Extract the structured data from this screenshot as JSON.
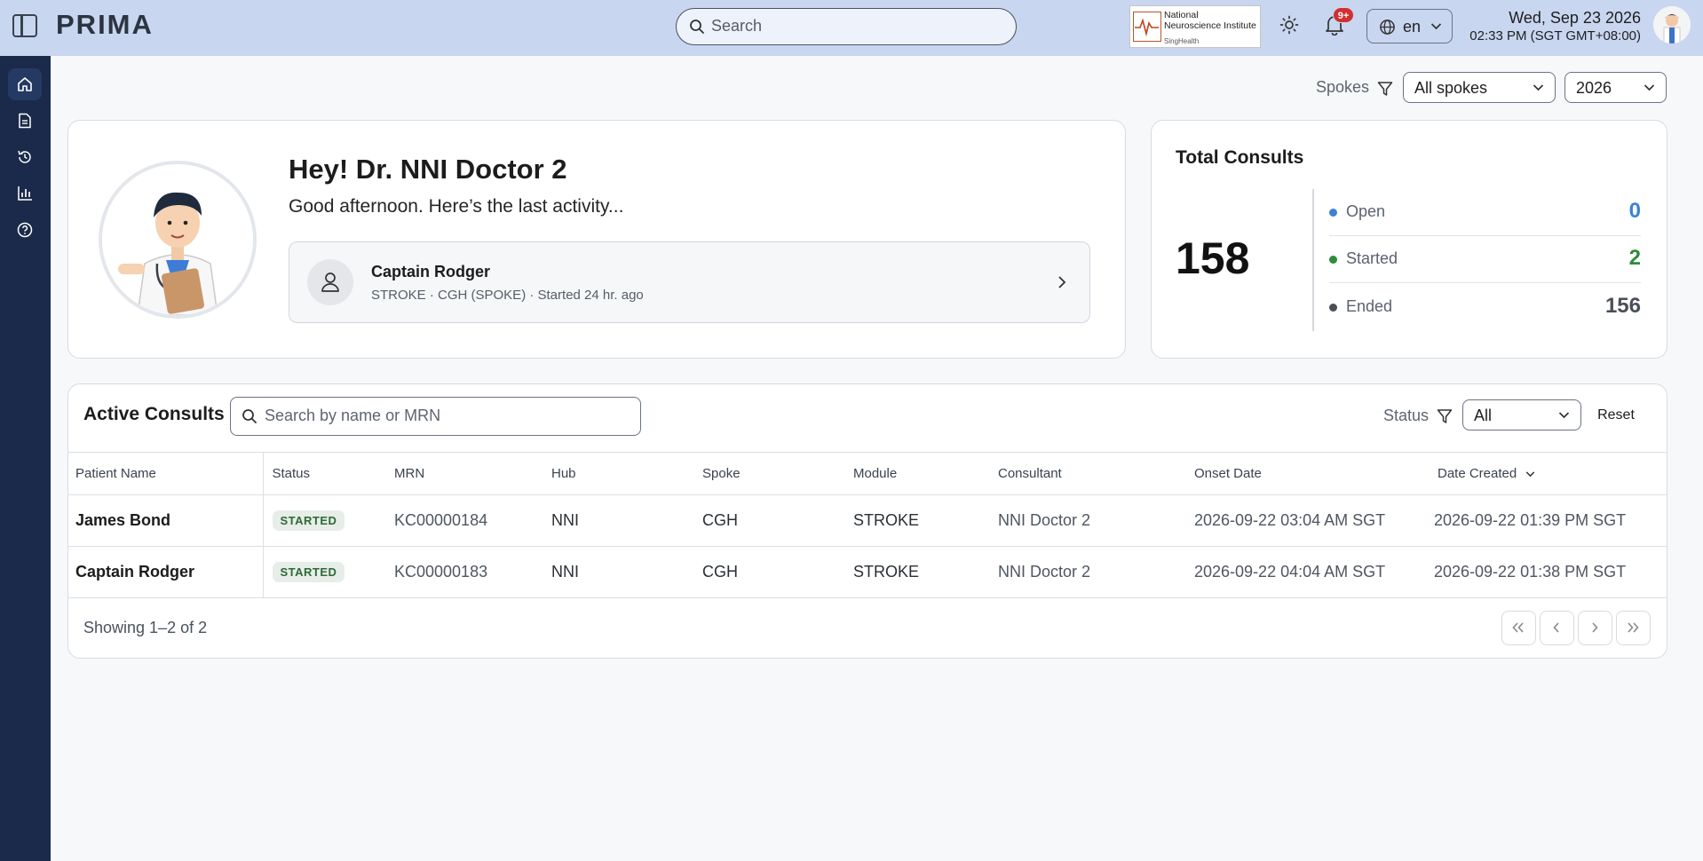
{
  "app": {
    "name": "PRIMA"
  },
  "header": {
    "search_placeholder": "Search",
    "logo": {
      "line1": "National",
      "line2": "Neuroscience Institute",
      "line3": "SingHealth"
    },
    "notifications_badge": "9+",
    "language": "en",
    "date": "Wed, Sep 23 2026",
    "time": "02:33 PM (SGT GMT+08:00)"
  },
  "sidebar": {
    "items": [
      {
        "name": "home",
        "active": true
      },
      {
        "name": "documents",
        "active": false
      },
      {
        "name": "history",
        "active": false
      },
      {
        "name": "analytics",
        "active": false
      },
      {
        "name": "help",
        "active": false
      }
    ]
  },
  "filters": {
    "spokes_label": "Spokes",
    "spokes_value": "All spokes",
    "year_value": "2026"
  },
  "welcome": {
    "greeting": "Hey! Dr. NNI Doctor 2",
    "subtitle": "Good afternoon. Here’s the last activity...",
    "last_activity": {
      "patient": "Captain Rodger",
      "meta": "STROKE · CGH (SPOKE) · Started 24 hr. ago"
    }
  },
  "total_consults": {
    "title": "Total Consults",
    "total": "158",
    "stats": [
      {
        "label": "Open",
        "value": "0",
        "color": "#3b82d6"
      },
      {
        "label": "Started",
        "value": "2",
        "color": "#2e8b3a"
      },
      {
        "label": "Ended",
        "value": "156",
        "color": "#4a4f57"
      }
    ]
  },
  "active_consults": {
    "title": "Active Consults",
    "search_placeholder": "Search by name or MRN",
    "status_label": "Status",
    "status_value": "All",
    "reset_label": "Reset",
    "columns": [
      "Patient Name",
      "Status",
      "MRN",
      "Hub",
      "Spoke",
      "Module",
      "Consultant",
      "Onset Date",
      "Date Created"
    ],
    "rows": [
      {
        "patient": "James Bond",
        "status": "STARTED",
        "mrn": "KC00000184",
        "hub": "NNI",
        "spoke": "CGH",
        "module": "STROKE",
        "consultant": "NNI Doctor 2",
        "onset": "2026-09-22 03:04 AM SGT",
        "created": "2026-09-22 01:39 PM SGT"
      },
      {
        "patient": "Captain Rodger",
        "status": "STARTED",
        "mrn": "KC00000183",
        "hub": "NNI",
        "spoke": "CGH",
        "module": "STROKE",
        "consultant": "NNI Doctor 2",
        "onset": "2026-09-22 04:04 AM SGT",
        "created": "2026-09-22 01:38 PM SGT"
      }
    ],
    "showing": "Showing 1–2 of 2"
  }
}
